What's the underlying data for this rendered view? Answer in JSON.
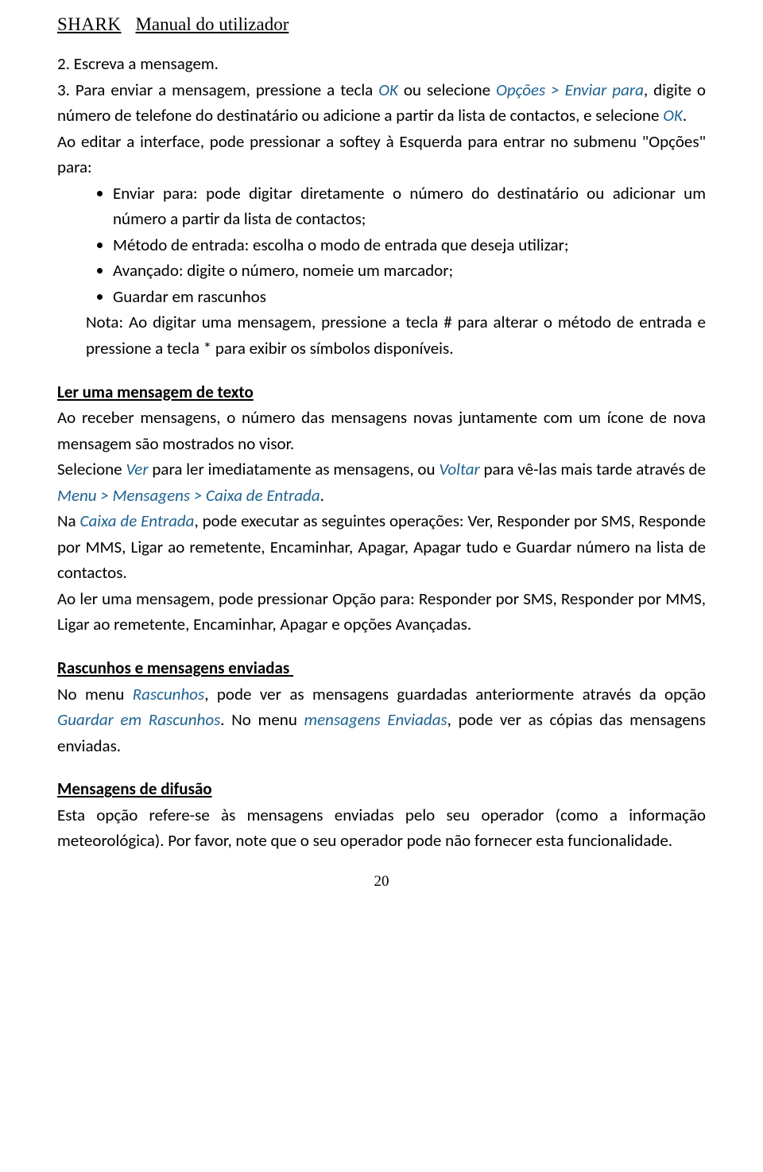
{
  "header": {
    "brand": "SHARK",
    "doc": "Manual do utilizador"
  },
  "p1": "2. Escreva a mensagem.",
  "p2a": "3. Para enviar a mensagem, pressione a tecla ",
  "p2_ok1": "OK",
  "p2b": " ou selecione ",
  "p2_opts": "Opções > Enviar para",
  "p2c": ", digite o número de telefone do destinatário ou adicione a partir da lista de contactos, e selecione ",
  "p2_ok2": "OK",
  "p2d": ".",
  "p3": "Ao editar a interface, pode pressionar a softey à Esquerda para entrar no submenu \"Opções\" para:",
  "bullets": {
    "b1": "Enviar para: pode digitar diretamente o número do destinatário ou adicionar um número a partir da lista de contactos;",
    "b2": "Método de entrada: escolha o modo de entrada que deseja utilizar;",
    "b3": "Avançado: digite o número, nomeie um marcador;",
    "b4": "Guardar em rascunhos"
  },
  "note": "Nota: Ao digitar uma mensagem, pressione a tecla # para alterar o método de entrada e pressione a tecla * para exibir os símbolos disponíveis.",
  "s2": {
    "title": "Ler uma mensagem de texto",
    "p1": "Ao receber mensagens, o número das mensagens novas juntamente com um ícone de nova mensagem são mostrados no visor.",
    "p2a": "Selecione ",
    "p2_ver": "Ver",
    "p2b": " para ler imediatamente as mensagens, ou ",
    "p2_voltar": "Voltar",
    "p2c": " para vê-las mais tarde através de ",
    "p2_path": "Menu > Mensagens > Caixa de Entrada",
    "p2d": ".",
    "p3a": "Na ",
    "p3_inbox": "Caixa de Entrada",
    "p3b": ", pode executar as seguintes operações: Ver, Responder por SMS, Responde por MMS, Ligar ao remetente, Encaminhar, Apagar, Apagar tudo e Guardar número na lista de contactos.",
    "p4": "Ao ler uma mensagem, pode pressionar Opção para: Responder por SMS, Responder por MMS, Ligar ao remetente, Encaminhar, Apagar e opções Avançadas."
  },
  "s3": {
    "title": "Rascunhos e mensagens enviadas",
    "p1a": "No menu ",
    "p1_rasc": "Rascunhos",
    "p1b": ", pode ver as mensagens guardadas anteriormente através da opção ",
    "p1_guard": "Guardar em Rascunhos",
    "p1c": ". No menu ",
    "p1_env": "mensagens Enviadas",
    "p1d": ", pode ver as cópias das mensagens enviadas."
  },
  "s4": {
    "title": "Mensagens de difusão",
    "p1": "Esta opção refere-se às mensagens enviadas pelo seu operador (como a informação meteorológica). Por favor, note que o seu operador pode não fornecer esta funcionalidade."
  },
  "pagenum": "20"
}
